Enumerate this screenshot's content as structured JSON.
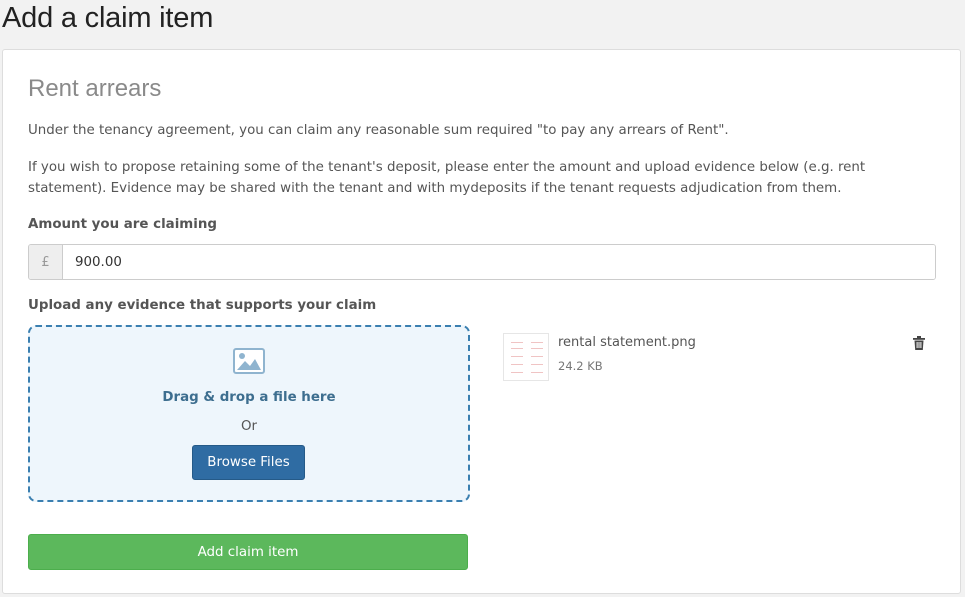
{
  "page": {
    "title": "Add a claim item"
  },
  "claim": {
    "heading": "Rent arrears",
    "intro": "Under the tenancy agreement, you can claim any reasonable sum required \"to pay any arrears of Rent\".",
    "instructions": "If you wish to propose retaining some of the tenant's deposit, please enter the amount and upload evidence below (e.g. rent statement). Evidence may be shared with the tenant and with mydeposits if the tenant requests adjudication from them."
  },
  "amount": {
    "label": "Amount you are claiming",
    "currency_symbol": "£",
    "value": "900.00"
  },
  "upload": {
    "label": "Upload any evidence that supports your claim",
    "dropzone_text": "Drag & drop a file here",
    "or_text": "Or",
    "browse_label": "Browse Files",
    "icon": "image-icon"
  },
  "files": [
    {
      "name": "rental statement.png",
      "size": "24.2 KB",
      "delete_icon": "trash-icon"
    }
  ],
  "actions": {
    "submit_label": "Add claim item"
  },
  "colors": {
    "primary": "#2f6ca3",
    "success": "#5cb85c",
    "dropzone_border": "#3a7fb0",
    "dropzone_bg": "#eef6fc"
  }
}
